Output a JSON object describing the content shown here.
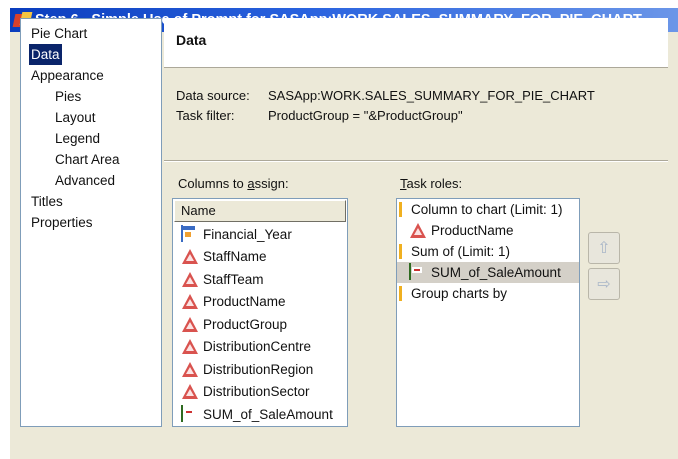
{
  "window": {
    "title": "Step 6 - Simple Use of Prompt for SASApp:WORK.SALES_SUMMARY_FOR_PIE_CHART"
  },
  "nav": {
    "items": [
      {
        "label": "Pie Chart",
        "indent": false,
        "selected": false
      },
      {
        "label": "Data",
        "indent": false,
        "selected": true
      },
      {
        "label": "Appearance",
        "indent": false,
        "selected": false
      },
      {
        "label": "Pies",
        "indent": true,
        "selected": false
      },
      {
        "label": "Layout",
        "indent": true,
        "selected": false
      },
      {
        "label": "Legend",
        "indent": true,
        "selected": false
      },
      {
        "label": "Chart Area",
        "indent": true,
        "selected": false
      },
      {
        "label": "Advanced",
        "indent": true,
        "selected": false
      },
      {
        "label": "Titles",
        "indent": false,
        "selected": false
      },
      {
        "label": "Properties",
        "indent": false,
        "selected": false
      }
    ]
  },
  "panel": {
    "title": "Data",
    "data_source_label": "Data source:",
    "data_source_value": "SASApp:WORK.SALES_SUMMARY_FOR_PIE_CHART",
    "task_filter_label": "Task filter:",
    "task_filter_value": "ProductGroup = \"&ProductGroup\""
  },
  "columns": {
    "label_prefix": "Columns to ",
    "label_mnemonic": "a",
    "label_suffix": "ssign:",
    "header": "Name",
    "items": [
      {
        "name": "Financial_Year",
        "icon": "calendar-icon"
      },
      {
        "name": "StaffName",
        "icon": "character-column-icon"
      },
      {
        "name": "StaffTeam",
        "icon": "character-column-icon"
      },
      {
        "name": "ProductName",
        "icon": "character-column-icon"
      },
      {
        "name": "ProductGroup",
        "icon": "character-column-icon"
      },
      {
        "name": "DistributionCentre",
        "icon": "character-column-icon"
      },
      {
        "name": "DistributionRegion",
        "icon": "character-column-icon"
      },
      {
        "name": "DistributionSector",
        "icon": "character-column-icon"
      },
      {
        "name": "SUM_of_SaleAmount",
        "icon": "numeric-column-icon"
      }
    ]
  },
  "task_roles": {
    "label_mnemonic": "T",
    "label_suffix": "ask roles:",
    "rows": [
      {
        "type": "group",
        "label": "Column to chart  (Limit: 1)"
      },
      {
        "type": "child",
        "label": "ProductName",
        "icon": "character-column-icon",
        "selected": false
      },
      {
        "type": "group",
        "label": "Sum of  (Limit: 1)"
      },
      {
        "type": "child",
        "label": "SUM_of_SaleAmount",
        "icon": "numeric-column-icon",
        "selected": true
      },
      {
        "type": "group",
        "label": "Group charts by"
      }
    ]
  },
  "buttons": {
    "move_up": "⇧",
    "move_down": "⇨"
  }
}
